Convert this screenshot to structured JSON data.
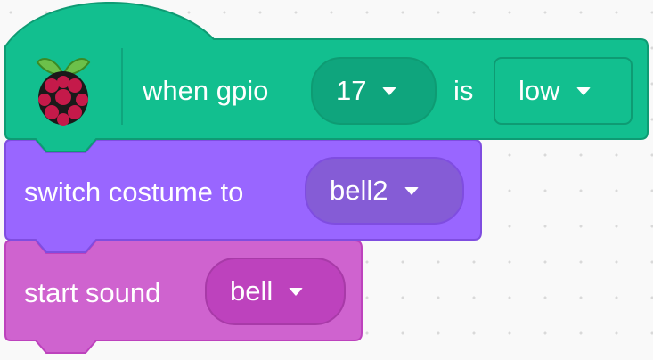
{
  "colors": {
    "gpio_block": "#12bf8f",
    "gpio_block_dark": "#0e9b73",
    "gpio_field": "#0fa57d",
    "looks_block": "#9966ff",
    "looks_block_dark": "#7f4de0",
    "looks_field": "#855cd6",
    "sound_block": "#cf63cf",
    "sound_block_dark": "#bd42bd",
    "sound_field": "#bd42bd",
    "canvas_background": "#f9f9f9"
  },
  "hat_block": {
    "icon": "raspberry-pi-icon",
    "label_when": "when gpio",
    "pin_value": "17",
    "label_is": "is",
    "state_value": "low"
  },
  "costume_block": {
    "label": "switch costume to",
    "costume_value": "bell2"
  },
  "sound_block": {
    "label": "start sound",
    "sound_value": "bell"
  }
}
